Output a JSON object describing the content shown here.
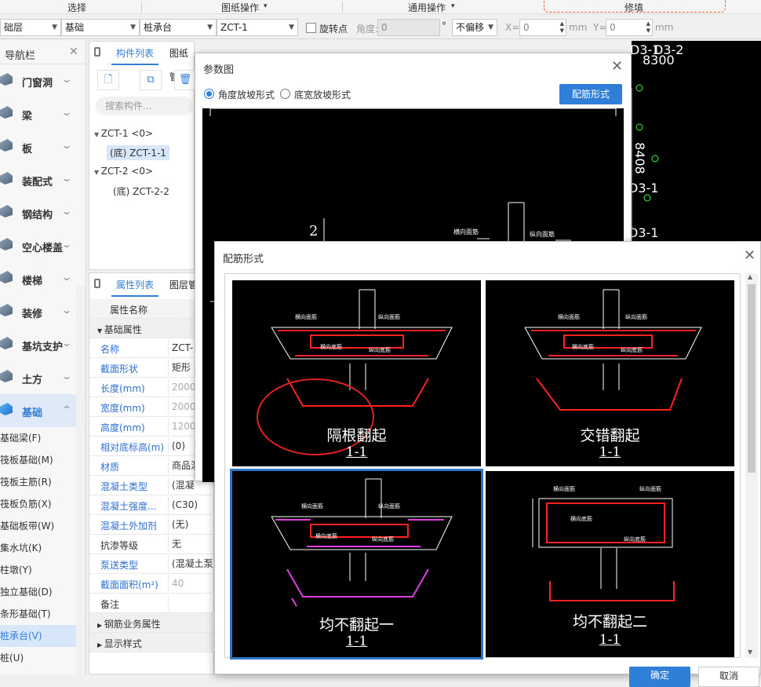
{
  "ribbon": {
    "groups": [
      "选择",
      "图纸操作",
      "通用操作",
      "修填"
    ],
    "dropdown_mark": "▾"
  },
  "toolbar": {
    "floor": "础层",
    "category": "基础",
    "component_type": "桩承台",
    "component": "ZCT-1",
    "rotate_label": "旋转点",
    "angle_label": "角度:",
    "angle_value": "0",
    "degree_unit": "°",
    "offset_mode": "不偏移",
    "x_label": "X=",
    "x_value": "0",
    "y_label": "Y=",
    "y_value": "0",
    "unit": "mm"
  },
  "nav": {
    "title": "导航栏",
    "categories": [
      {
        "label": "门窗洞"
      },
      {
        "label": "梁"
      },
      {
        "label": "板"
      },
      {
        "label": "装配式"
      },
      {
        "label": "钢结构"
      },
      {
        "label": "空心楼盖"
      },
      {
        "label": "楼梯"
      },
      {
        "label": "装修"
      },
      {
        "label": "基坑支护"
      },
      {
        "label": "土方"
      },
      {
        "label": "基础"
      }
    ],
    "sub_items": [
      "基础梁(F)",
      "筏板基础(M)",
      "筏板主筋(R)",
      "筏板负筋(X)",
      "基础板带(W)",
      "集水坑(K)",
      "柱墩(Y)",
      "独立基础(D)",
      "条形基础(T)",
      "桩承台(V)",
      "桩(U)"
    ]
  },
  "component_panel": {
    "tabs": [
      "构件列表",
      "图纸管理"
    ],
    "search_placeholder": "搜索构件...",
    "tree": [
      {
        "label": "ZCT-1 <0>"
      },
      {
        "label": "(底) ZCT-1-1"
      },
      {
        "label": "ZCT-2 <0>"
      },
      {
        "label": "(底) ZCT-2-2"
      }
    ]
  },
  "properties_panel": {
    "tabs": [
      "属性列表",
      "图层管"
    ],
    "header": "属性名称",
    "group_basic": "基础属性",
    "rows": [
      {
        "name": "名称",
        "value": "ZCT-"
      },
      {
        "name": "截面形状",
        "value": "矩形"
      },
      {
        "name": "长度(mm)",
        "value": "2000"
      },
      {
        "name": "宽度(mm)",
        "value": "2000"
      },
      {
        "name": "高度(mm)",
        "value": "1200"
      },
      {
        "name": "相对底标高(m)",
        "value": "(0)"
      },
      {
        "name": "材质",
        "value": "商品混"
      },
      {
        "name": "混凝土类型",
        "value": "(混凝"
      },
      {
        "name": "混凝土强度...",
        "value": "(C30)"
      },
      {
        "name": "混凝土外加剂",
        "value": "(无)"
      },
      {
        "name": "抗渗等级",
        "value": "无"
      },
      {
        "name": "泵送类型",
        "value": "(混凝土泵)"
      },
      {
        "name": "截面面积(m²)",
        "value": "40"
      },
      {
        "name": "备注",
        "value": ""
      }
    ],
    "group_rebar": "钢筋业务属性",
    "group_display": "显示样式"
  },
  "canvas": {
    "labels": [
      "D3-1",
      "D3-2",
      "8300",
      "8408",
      "8408",
      "D3-1",
      "D3-1"
    ]
  },
  "param_dialog": {
    "title": "参数图",
    "radio_angle": "角度放坡形式",
    "radio_width": "底宽放坡形式",
    "button": "配筋形式",
    "drawing_label": "2",
    "rebar_label_1": "横向面筋",
    "rebar_label_2": "纵向面筋"
  },
  "rebar_dialog": {
    "title": "配筋形式",
    "options": [
      {
        "caption": "隔根翻起",
        "section": "1-1"
      },
      {
        "caption": "交错翻起",
        "section": "1-1"
      },
      {
        "caption": "均不翻起一",
        "section": "1-1"
      },
      {
        "caption": "均不翻起二",
        "section": "1-1"
      }
    ],
    "diagram_labels": {
      "top_transverse": "横向面筋",
      "top_long": "纵向面筋",
      "bot_transverse": "横向底筋",
      "bot_long": "纵向底筋"
    },
    "ok": "确定",
    "cancel": "取消"
  },
  "colors": {
    "accent": "#2f7fd8",
    "rebar_red": "#ff2020",
    "rebar_magenta": "#e040e0",
    "label_green": "#3cff3c"
  }
}
